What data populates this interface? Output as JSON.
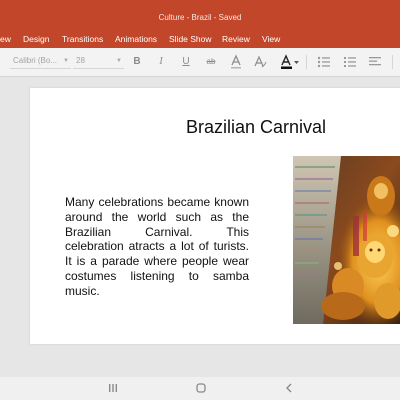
{
  "window": {
    "title": "Culture - Brazil - Saved"
  },
  "menu": {
    "items": [
      "ew",
      "Design",
      "Transitions",
      "Animations",
      "Slide Show",
      "Review",
      "View"
    ]
  },
  "toolbar": {
    "font_name": "Calibri (Bo...",
    "font_size": "28"
  },
  "slide": {
    "title": "Brazilian Carnival",
    "body": "Many celebrations became known around the world such as the Brazilian Carnival. This celebration atracts a lot of turists. It is a parade where people wear costumes listening to samba music."
  },
  "nav": {
    "recent_icon": "recent-apps-icon",
    "home_icon": "home-icon",
    "back_icon": "back-icon"
  },
  "colors": {
    "accent": "#c2462a",
    "toolbar_bg": "#f3f3f3",
    "canvas_bg": "#e6e6e6"
  }
}
